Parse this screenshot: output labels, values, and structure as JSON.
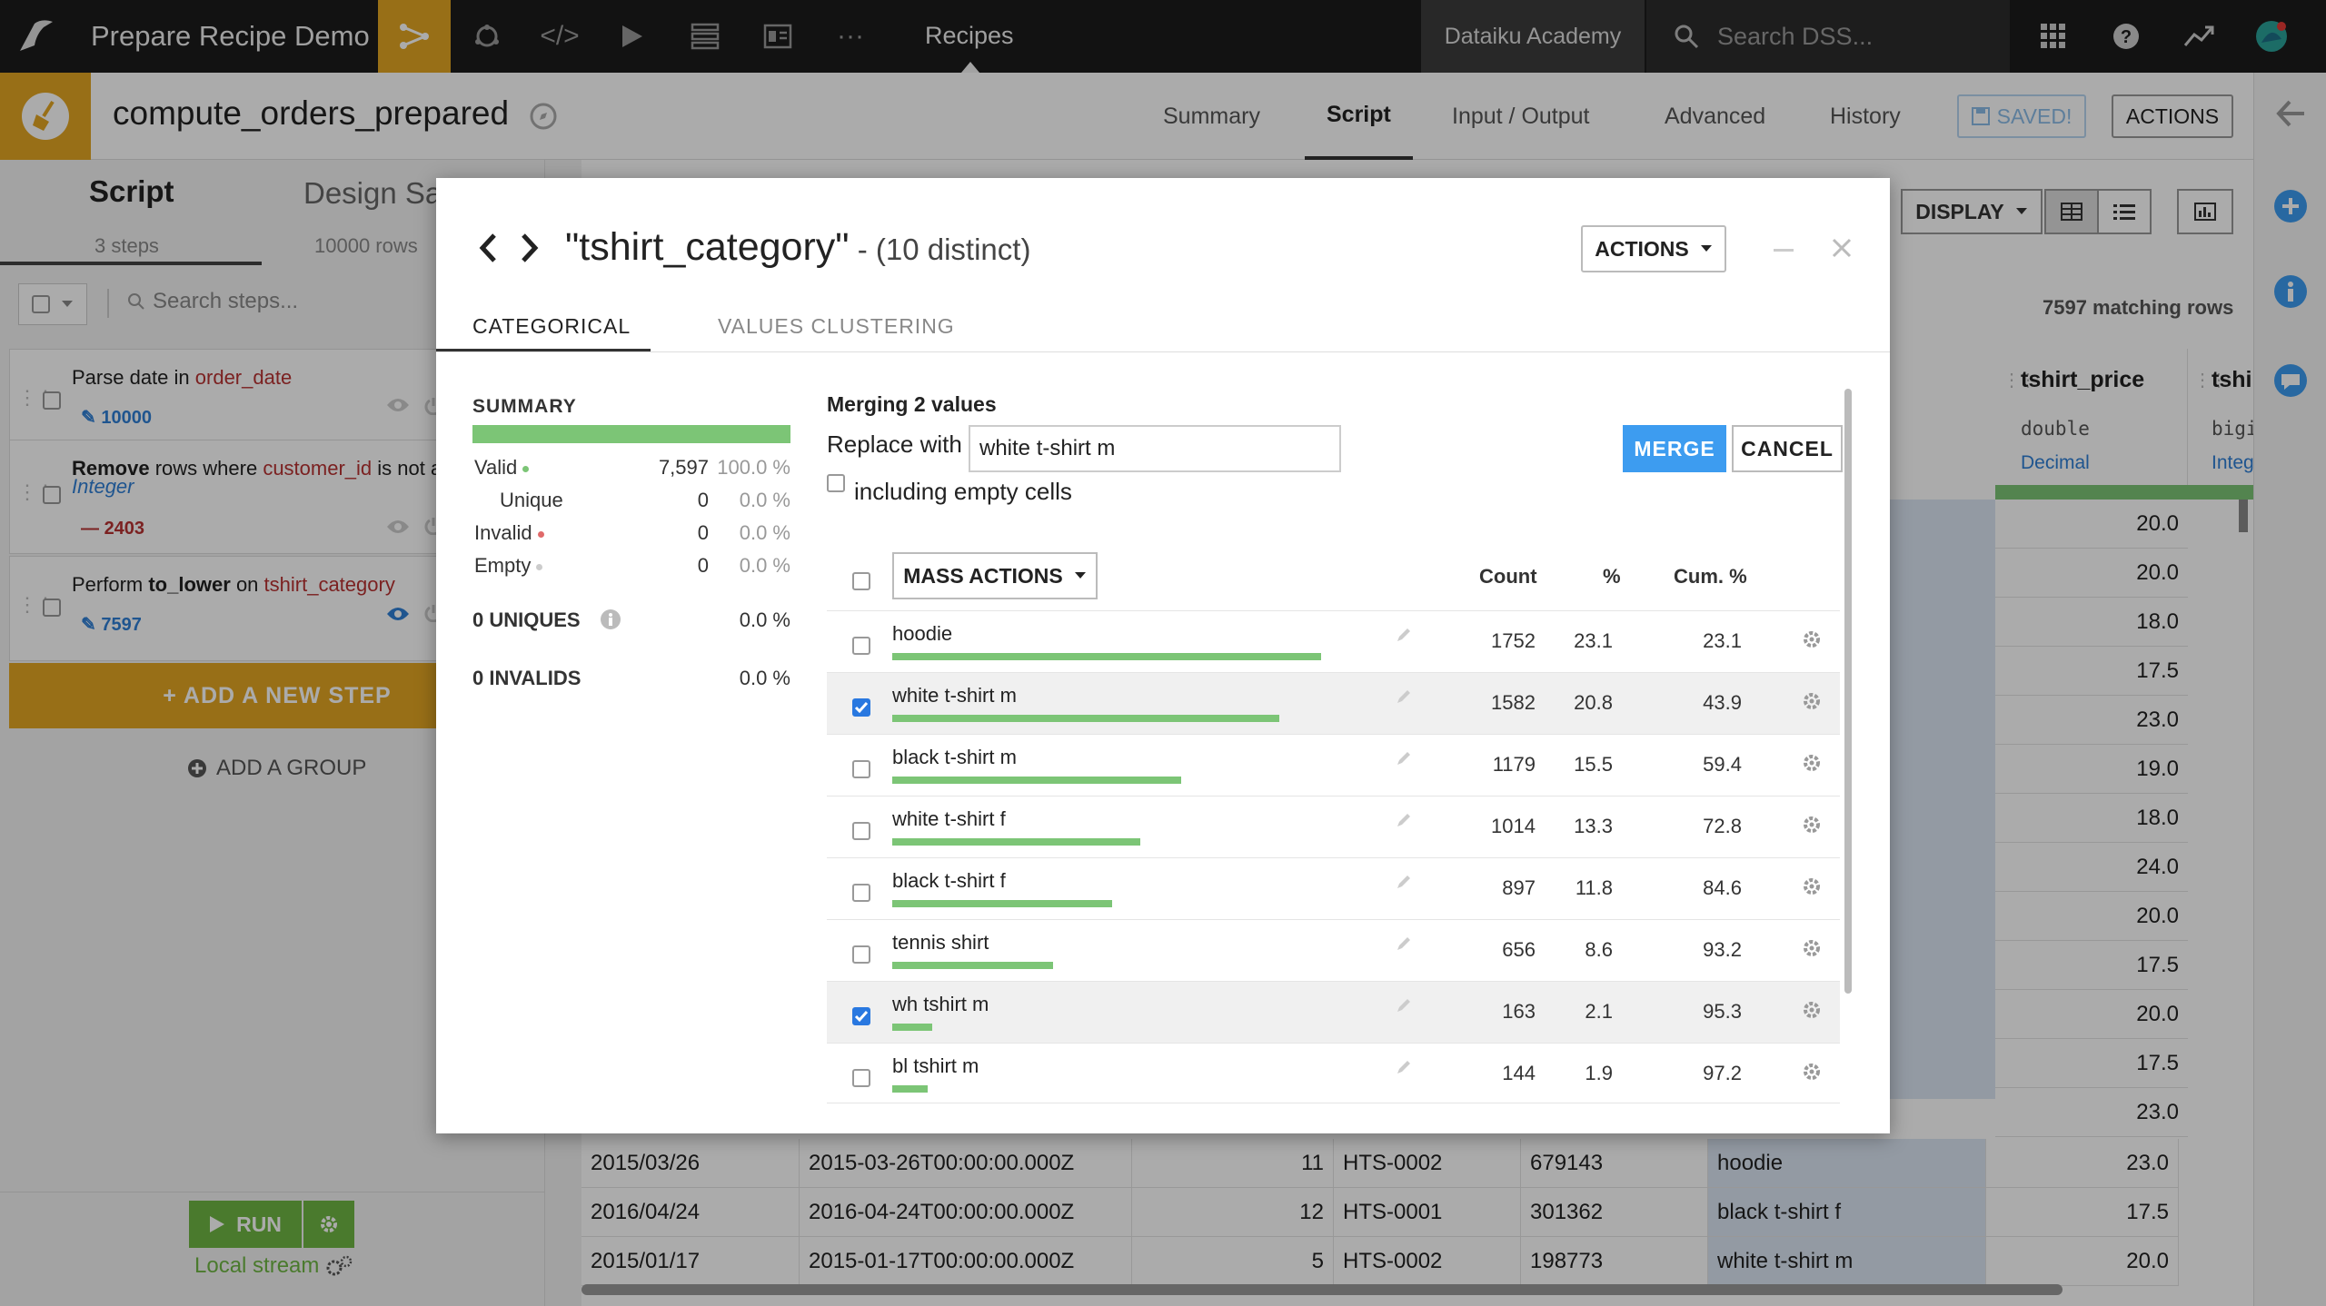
{
  "topbar": {
    "project_name": "Prepare Recipe Demo",
    "section": "Recipes",
    "academy": "Dataiku Academy",
    "search_placeholder": "Search DSS..."
  },
  "recipe": {
    "name": "compute_orders_prepared",
    "tabs": [
      "Summary",
      "Script",
      "Input / Output",
      "Advanced",
      "History"
    ],
    "active_tab": "Script",
    "saved_label": "SAVED!",
    "actions_label": "ACTIONS"
  },
  "left_panel": {
    "tab_script": "Script",
    "tab_design": "Design Sa",
    "steps_count": "3 steps",
    "rows_count": "10000 rows",
    "search_placeholder": "Search steps...",
    "steps": [
      {
        "prefix": "Parse date",
        "mid": " in ",
        "col": "order_date",
        "badge": "10000",
        "badge_color": "#2f7fd6"
      },
      {
        "prefix": "Remove",
        "mid": " rows where ",
        "col": "customer_id",
        "tail": " is not a",
        "type": "Integer",
        "badge": "2403",
        "badge_color": "#b83232"
      },
      {
        "prefix": "Perform ",
        "bold": "to_lower",
        "mid": " on ",
        "col": "tshirt_category",
        "badge": "7597",
        "badge_color": "#2f7fd6"
      }
    ],
    "add_step": "+ ADD A NEW STEP",
    "add_group": "ADD A GROUP",
    "run": "RUN",
    "engine": "Local stream"
  },
  "grid": {
    "display_label": "DISPLAY",
    "matching_rows": "7597 matching rows",
    "columns": [
      {
        "name": "tshirt_price",
        "type": "double",
        "meaning": "Decimal"
      },
      {
        "name": "tshi",
        "type": "bigin",
        "meaning": "Integer"
      }
    ],
    "price_values": [
      "20.0",
      "20.0",
      "18.0",
      "17.5",
      "23.0",
      "19.0",
      "18.0",
      "24.0",
      "20.0",
      "17.5",
      "20.0",
      "17.5",
      "23.0"
    ],
    "rows": [
      {
        "date": "2015/03/26",
        "ts": "2015-03-26T00:00:00.000Z",
        "n": "11",
        "code": "HTS-0002",
        "id": "679143",
        "cat": "hoodie",
        "price": "23.0"
      },
      {
        "date": "2016/04/24",
        "ts": "2016-04-24T00:00:00.000Z",
        "n": "12",
        "code": "HTS-0001",
        "id": "301362",
        "cat": "black t-shirt f",
        "price": "17.5"
      },
      {
        "date": "2015/01/17",
        "ts": "2015-01-17T00:00:00.000Z",
        "n": "5",
        "code": "HTS-0002",
        "id": "198773",
        "cat": "white t-shirt m",
        "price": "20.0"
      }
    ]
  },
  "modal": {
    "column": "\"tshirt_category\"",
    "distinct": " - (10 distinct)",
    "actions": "ACTIONS",
    "tabs": [
      "CATEGORICAL",
      "VALUES CLUSTERING"
    ],
    "summary_title": "SUMMARY",
    "summary": [
      {
        "label": "Valid",
        "count": "7,597",
        "pct": "100.0 %",
        "dot": "#7cc576"
      },
      {
        "label": "Unique",
        "count": "0",
        "pct": "0.0 %"
      },
      {
        "label": "Invalid",
        "count": "0",
        "pct": "0.0 %",
        "dot": "#e06a6a"
      },
      {
        "label": "Empty",
        "count": "0",
        "pct": "0.0 %",
        "dot": "#cccccc"
      }
    ],
    "uniques_label": "0 UNIQUES",
    "uniques_pct": "0.0 %",
    "invalids_label": "0 INVALIDS",
    "invalids_pct": "0.0 %",
    "merge_title": "Merging 2 values",
    "replace_label": "Replace with",
    "replace_value": "white t-shirt m",
    "include_empty": "including empty cells",
    "merge_btn": "MERGE",
    "cancel_btn": "CANCEL",
    "mass_actions": "MASS ACTIONS",
    "col_count": "Count",
    "col_pct": "%",
    "col_cum": "Cum. %",
    "values": [
      {
        "label": "hoodie",
        "count": "1752",
        "pct": "23.1",
        "cum": "23.1",
        "frac": 1.0,
        "checked": false
      },
      {
        "label": "white t-shirt m",
        "count": "1582",
        "pct": "20.8",
        "cum": "43.9",
        "frac": 0.903,
        "checked": true
      },
      {
        "label": "black t-shirt m",
        "count": "1179",
        "pct": "15.5",
        "cum": "59.4",
        "frac": 0.673,
        "checked": false
      },
      {
        "label": "white t-shirt f",
        "count": "1014",
        "pct": "13.3",
        "cum": "72.8",
        "frac": 0.579,
        "checked": false
      },
      {
        "label": "black t-shirt f",
        "count": "897",
        "pct": "11.8",
        "cum": "84.6",
        "frac": 0.512,
        "checked": false
      },
      {
        "label": "tennis shirt",
        "count": "656",
        "pct": "8.6",
        "cum": "93.2",
        "frac": 0.374,
        "checked": false
      },
      {
        "label": "wh tshirt m",
        "count": "163",
        "pct": "2.1",
        "cum": "95.3",
        "frac": 0.093,
        "checked": true
      },
      {
        "label": "bl tshirt m",
        "count": "144",
        "pct": "1.9",
        "cum": "97.2",
        "frac": 0.082,
        "checked": false
      }
    ]
  },
  "colors": {
    "accent": "#e3a623",
    "valid": "#7cc576",
    "merge": "#3d9cf0",
    "run": "#6fb744"
  }
}
